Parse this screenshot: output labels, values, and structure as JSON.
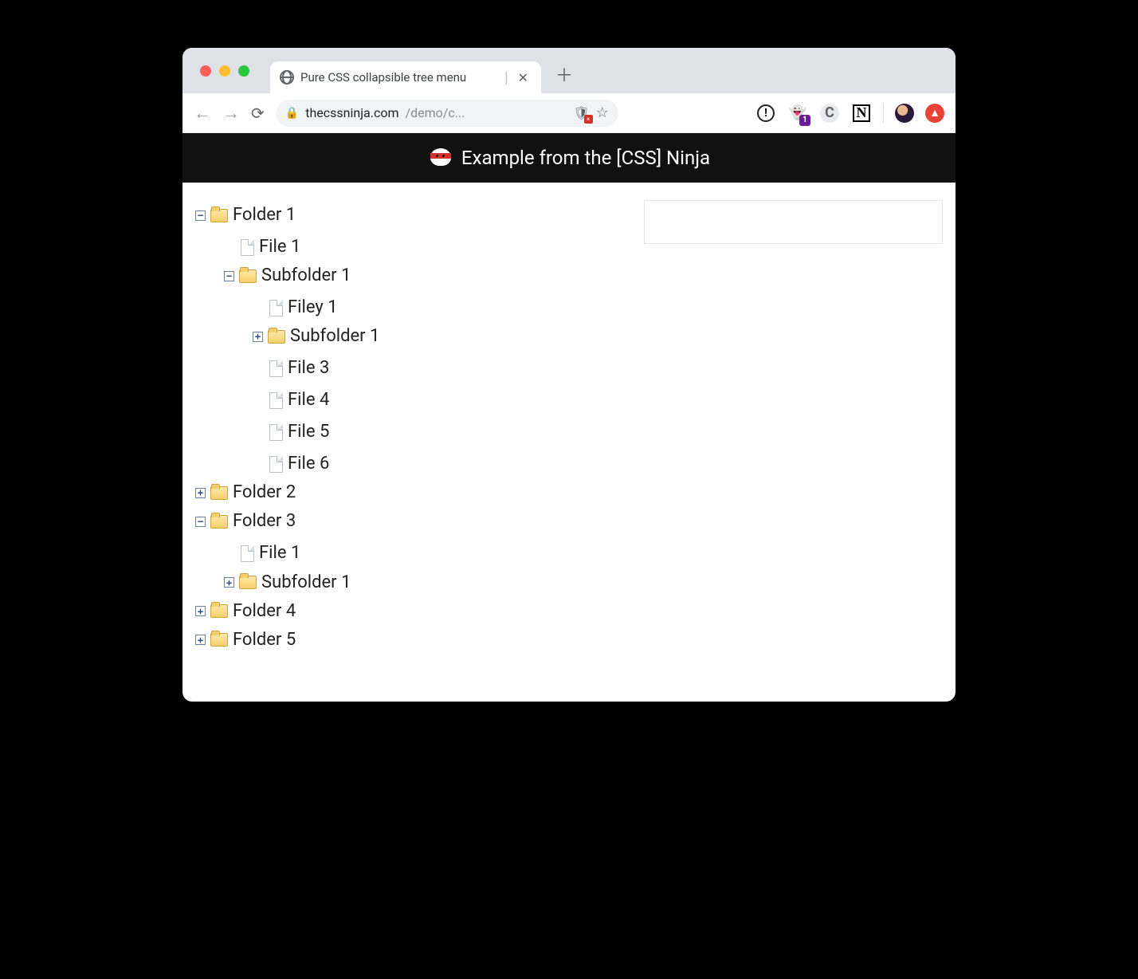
{
  "browser": {
    "tab_title": "Pure CSS collapsible tree menu",
    "url_host": "thecssninja.com",
    "url_path": "/demo/c...",
    "ghost_badge": "1"
  },
  "page": {
    "header_text": "Example from the [CSS] Ninja"
  },
  "tree": {
    "f1": "Folder 1",
    "f1_file1": "File 1",
    "f1_sub1": "Subfolder 1",
    "f1_sub1_filey1": "Filey 1",
    "f1_sub1_sub1": "Subfolder 1",
    "f1_sub1_file3": "File 3",
    "f1_sub1_file4": "File 4",
    "f1_sub1_file5": "File 5",
    "f1_sub1_file6": "File 6",
    "f2": "Folder 2",
    "f3": "Folder 3",
    "f3_file1": "File 1",
    "f3_sub1": "Subfolder 1",
    "f4": "Folder 4",
    "f5": "Folder 5"
  }
}
